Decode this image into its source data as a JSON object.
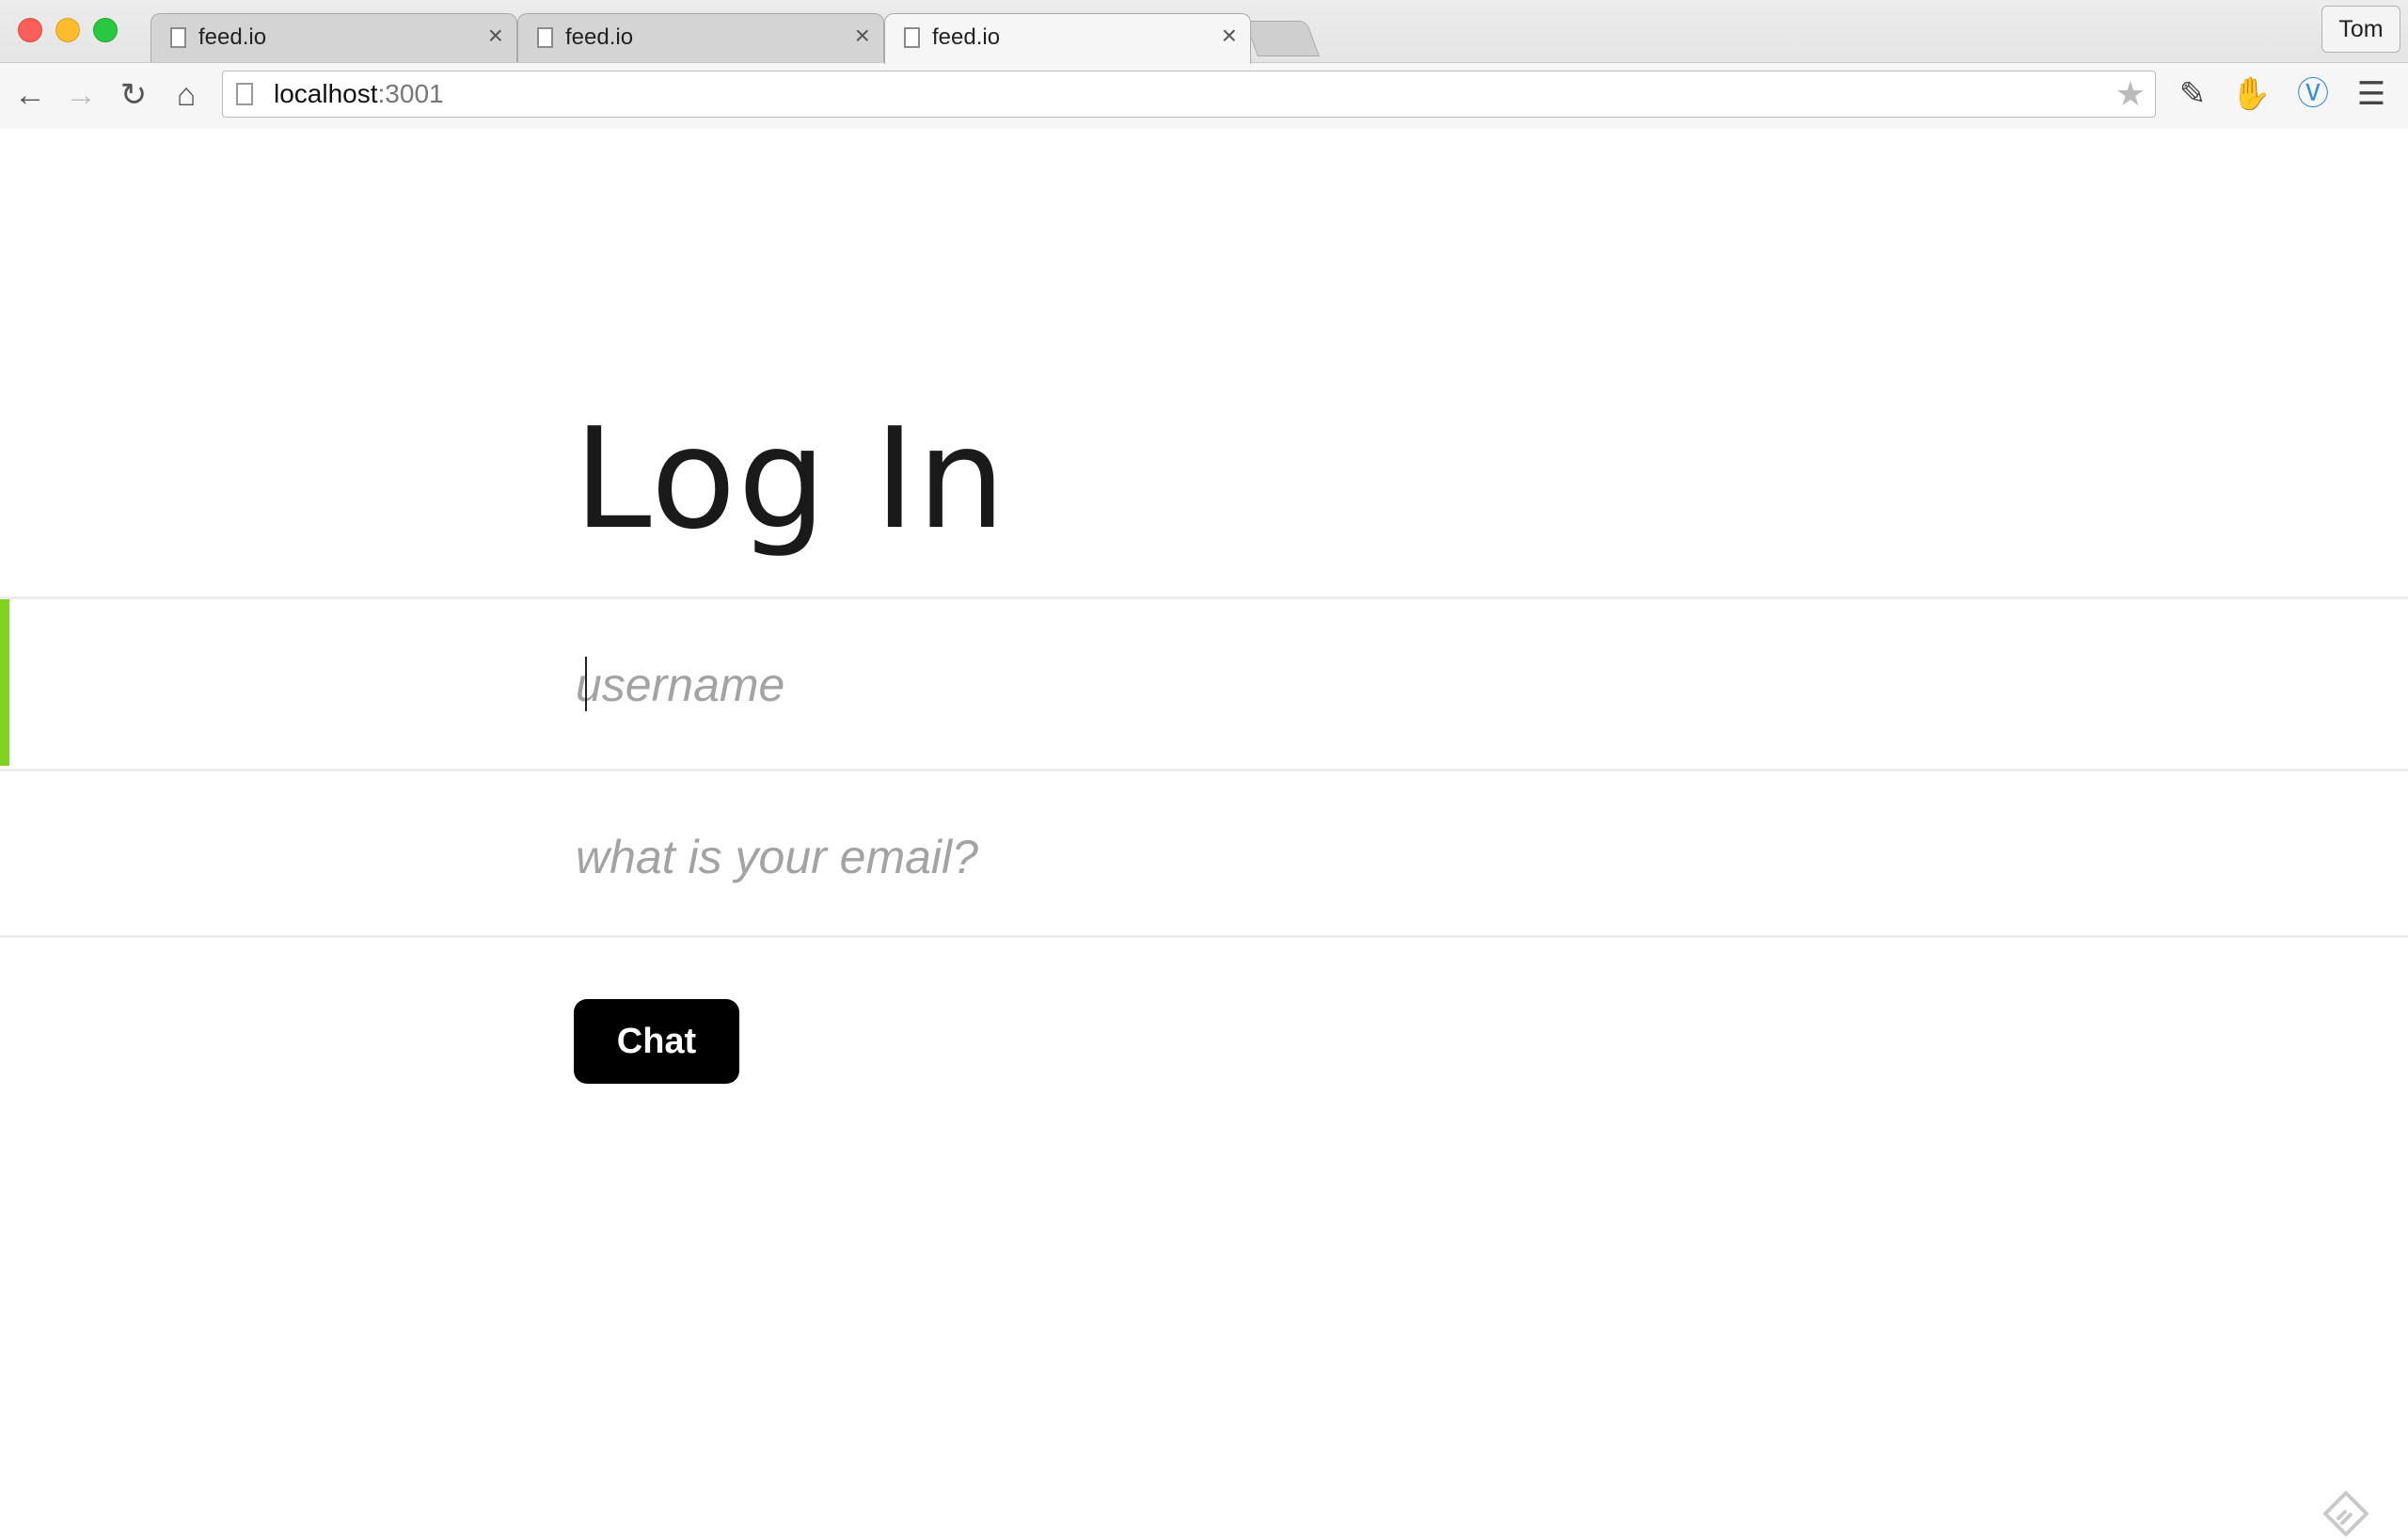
{
  "browser": {
    "tabs": [
      {
        "label": "feed.io"
      },
      {
        "label": "feed.io"
      },
      {
        "label": "feed.io"
      }
    ],
    "active_tab_index": 2,
    "profile_name": "Tom",
    "address": {
      "host": "localhost",
      "port": ":3001"
    },
    "close_glyph": "×"
  },
  "page": {
    "title": "Log In",
    "username": {
      "placeholder": "username",
      "value": ""
    },
    "email": {
      "placeholder": "what is your email?",
      "value": ""
    },
    "submit_label": "Chat",
    "focus_color": "#7ed321"
  }
}
